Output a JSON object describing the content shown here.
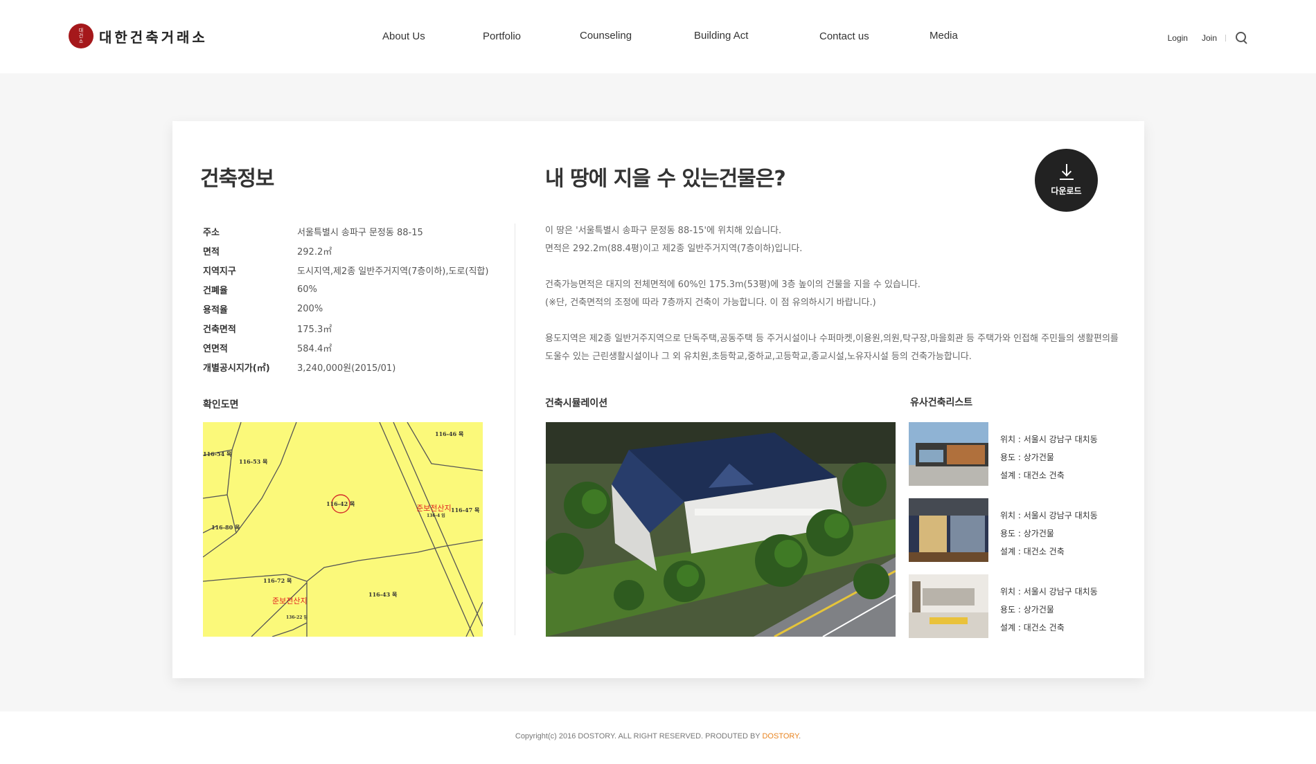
{
  "brand": {
    "seal_text": [
      "대",
      "건",
      "소"
    ],
    "name": "대한건축거래소"
  },
  "nav": [
    {
      "label": "About Us"
    },
    {
      "label": "Portfolio"
    },
    {
      "label": "Counseling"
    },
    {
      "label": "Building Act"
    },
    {
      "label": "Contact us"
    },
    {
      "label": "Media"
    }
  ],
  "util": {
    "login": "Login",
    "join": "Join",
    "search_icon": "search-icon"
  },
  "left": {
    "title": "건축정보",
    "info": [
      {
        "key": "주소",
        "value": "서울특별시 송파구 문정동 88-15"
      },
      {
        "key": "면적",
        "value": "292.2㎡"
      },
      {
        "key": "지역지구",
        "value": "도시지역,제2종 일반주거지역(7층이하),도로(직합)"
      },
      {
        "key": "건폐율",
        "value": "60%"
      },
      {
        "key": "용적율",
        "value": "200%"
      },
      {
        "key": "건축면적",
        "value": "175.3㎡"
      },
      {
        "key": "연면적",
        "value": "584.4㎡"
      },
      {
        "key": "개별공시지가(㎡)",
        "value": "3,240,000원(2015/01)"
      }
    ],
    "map_title": "확인도면",
    "map_labels": {
      "l1": "116-46 목",
      "l2": "116-54 목",
      "l3": "116-53 목",
      "l4": "116-42 목",
      "l5": "116-47 목",
      "l6": "116-80 목",
      "l7": "116-72 목",
      "l8": "116-43 목",
      "l9": "136-4 임",
      "l10": "136-22 임",
      "r1": "준보전산지",
      "r2": "준보전산지"
    }
  },
  "right": {
    "title": "내 땅에 지을 수 있는건물은?",
    "download_label": "다운로드",
    "desc": [
      "이 땅은 '서울특별시 송파구 문정동 88-15'에 위치해 있습니다.",
      "면적은 292.2m(88.4평)이고 제2종 일반주거지역(7층이하)입니다.",
      "",
      "건축가능면적은 대지의 전체면적에 60%인 175.3m(53평)에 3층 높이의 건물을 지을 수 있습니다.",
      "(※단, 건축면적의 조정에 따라 7층까지 건축이 가능합니다. 이 점 유의하시기 바랍니다.)",
      "",
      "용도지역은 제2종 일반거주지역으로 단독주택,공동주택 등 주거시설이나 수퍼마켓,이용원,의원,탁구장,마을회관 등 주택가와 인접해 주민들의 생활편의를",
      "도울수 있는 근린생활시설이나 그 외 유치원,초등학교,중하교,고등학교,종교시설,노유자시설 등의 건축가능합니다."
    ],
    "sim_title": "건축시뮬레이션",
    "similar_title": "유사건축리스트",
    "similar": [
      {
        "location": "위치 : 서울시 강남구 대치동",
        "use": "용도 : 상가건물",
        "design": "설계 : 대건소 건축"
      },
      {
        "location": "위치 : 서울시 강남구 대치동",
        "use": "용도 : 상가건물",
        "design": "설계 : 대건소 건축"
      },
      {
        "location": "위치 : 서울시 강남구 대치동",
        "use": "용도 : 상가건물",
        "design": "설계 : 대건소 건축"
      }
    ]
  },
  "footer": {
    "text": "Copyright(c) 2016 DOSTORY. ALL RIGHT RESERVED. PRODUTED BY ",
    "link": "DOSTORY",
    "end": "."
  },
  "colors": {
    "seal": "#a5181b",
    "map_bg": "#fbf97a",
    "footer_link": "#e8831e",
    "button": "#222222"
  }
}
